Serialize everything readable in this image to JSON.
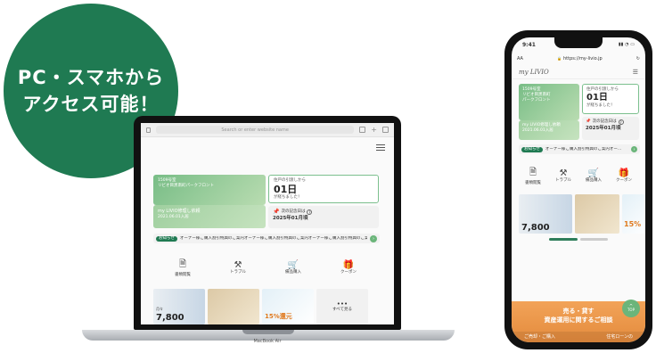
{
  "badge": {
    "line1": "PC・スマホから",
    "line2": "アクセス可能！",
    "color": "#1f7a52"
  },
  "laptop": {
    "url_placeholder": "Search or enter website name",
    "model_label": "MacBook Air",
    "project_year": "1509号室",
    "project_name": "リビオ目黒南町パークフロント",
    "repair_title": "my LIVIO修理し依頼",
    "repair_date": "2021.06.01入居",
    "move_in_label": "住戸の引渡しから",
    "move_in_days": "01日",
    "move_in_sub": "が経ちました！",
    "anniversary_label": "次の記念日は",
    "anniversary_value": "2025年01月頃",
    "notice_tag": "お知らせ",
    "notice_text": "オーナー様ご購入割引特典のご案内オーナー様ご購入割引特典のご案内オーナー様ご購入割引特典のご案内",
    "menu": [
      {
        "icon": "document-icon",
        "label": "書類閲覧"
      },
      {
        "icon": "hammer-icon",
        "label": "トラブル"
      },
      {
        "icon": "cart-icon",
        "label": "備品購入"
      },
      {
        "icon": "gift-icon",
        "label": "クーポン"
      }
    ],
    "banner_price": "7,800",
    "banner_price_prefix": "月々",
    "banner_discount": "15%還元",
    "more_label": "すべて見る"
  },
  "phone": {
    "time": "9:41",
    "aa": "AA",
    "url": "https://my-livio.jp",
    "logo": "my LIVIO",
    "project_year": "1509号室",
    "project_name_1": "リビオ目黒南町",
    "project_name_2": "パークフロント",
    "repair_title": "my LIVIO修理し依頼",
    "repair_date": "2021.06.01入居",
    "move_in_label": "住戸の引渡しから",
    "move_in_days": "01日",
    "move_in_sub": "が経ちました！",
    "anniversary_label": "次の記念日は",
    "anniversary_value": "2025年01月頃",
    "notice_tag": "お知らせ",
    "notice_text": "オーナー様ご購入割引特典のご案内オー...",
    "menu": [
      {
        "icon": "document-icon",
        "label": "書類閲覧"
      },
      {
        "icon": "hammer-icon",
        "label": "トラブル"
      },
      {
        "icon": "cart-icon",
        "label": "備品購入"
      },
      {
        "icon": "gift-icon",
        "label": "クーポン"
      }
    ],
    "banner_price": "7,800",
    "banner_discount": "15%",
    "top_button": "TOP",
    "cta_line1": "売る・貸す",
    "cta_line2": "資産運用に関するご相談",
    "footer_left": "ご売却・ご購入",
    "footer_right": "住宅ローンの"
  }
}
